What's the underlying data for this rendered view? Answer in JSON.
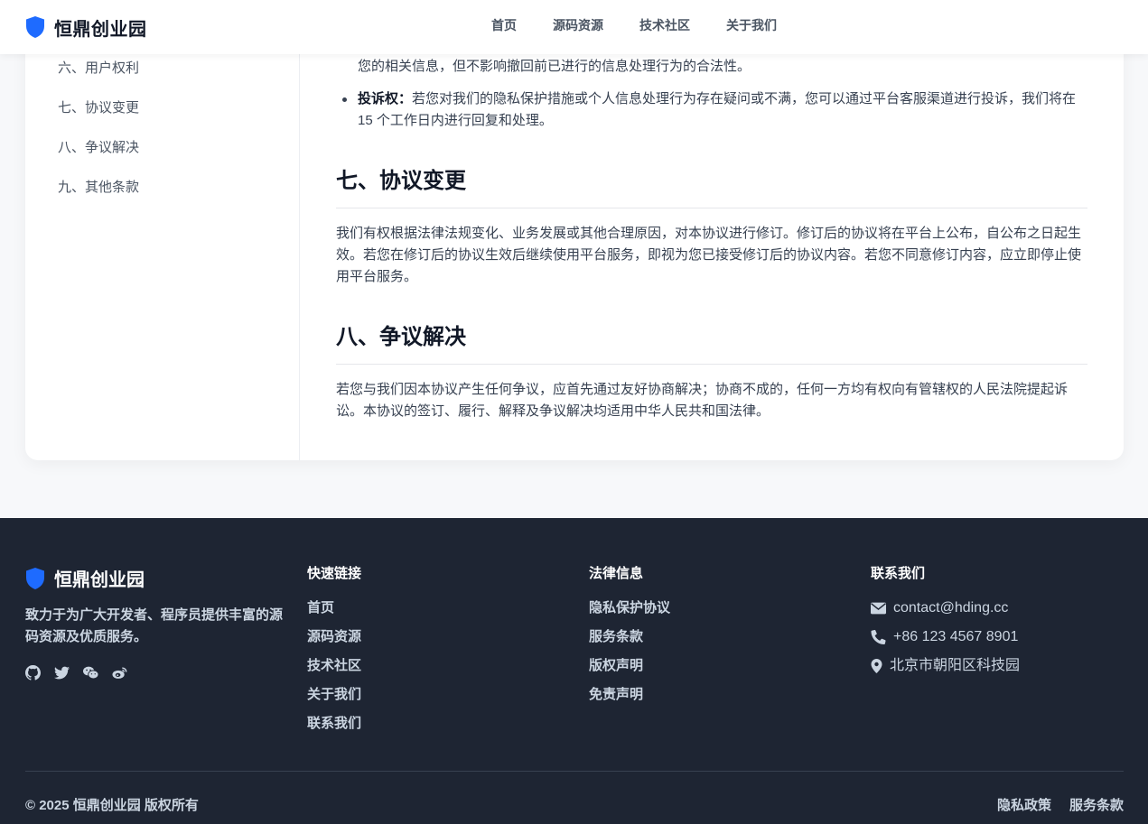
{
  "header": {
    "brand": "恒鼎创业园",
    "nav": [
      "首页",
      "源码资源",
      "技术社区",
      "关于我们"
    ]
  },
  "toc": {
    "items": [
      "六、用户权利",
      "七、协议变更",
      "八、争议解决",
      "九、其他条款"
    ]
  },
  "content": {
    "bullet_1_cont": "您的相关信息，但不影响撤回前已进行的信息处理行为的合法性。",
    "bullet_2_label": "投诉权：",
    "bullet_2_text": "若您对我们的隐私保护措施或个人信息处理行为存在疑问或不满，您可以通过平台客服渠道进行投诉，我们将在 15 个工作日内进行回复和处理。",
    "section_7_title": "七、协议变更",
    "section_7_text": "我们有权根据法律法规变化、业务发展或其他合理原因，对本协议进行修订。修订后的协议将在平台上公布，自公布之日起生效。若您在修订后的协议生效后继续使用平台服务，即视为您已接受修订后的协议内容。若您不同意修订内容，应立即停止使用平台服务。",
    "section_8_title": "八、争议解决",
    "section_8_text": "若您与我们因本协议产生任何争议，应首先通过友好协商解决；协商不成的，任何一方均有权向有管辖权的人民法院提起诉讼。本协议的签订、履行、解释及争议解决均适用中华人民共和国法律。"
  },
  "footer": {
    "brand": "恒鼎创业园",
    "description": "致力于为广大开发者、程序员提供丰富的源码资源及优质服务。",
    "socials": [
      "github-icon",
      "twitter-icon",
      "wechat-icon",
      "weibo-icon"
    ],
    "quick_links": {
      "title": "快速链接",
      "links": [
        "首页",
        "源码资源",
        "技术社区",
        "关于我们",
        "联系我们"
      ]
    },
    "legal": {
      "title": "法律信息",
      "links": [
        "隐私保护协议",
        "服务条款",
        "版权声明",
        "免责声明"
      ]
    },
    "contact": {
      "title": "联系我们",
      "email": "contact@hding.cc",
      "phone": "+86 123 4567 8901",
      "address": "北京市朝阳区科技园"
    },
    "copyright": "© 2025 恒鼎创业园 版权所有",
    "bottom_links": [
      "隐私政策",
      "服务条款"
    ]
  },
  "colors": {
    "brand_blue": "#1e6bff",
    "footer_bg": "#1e2533",
    "page_bg": "#f7f8fa"
  }
}
